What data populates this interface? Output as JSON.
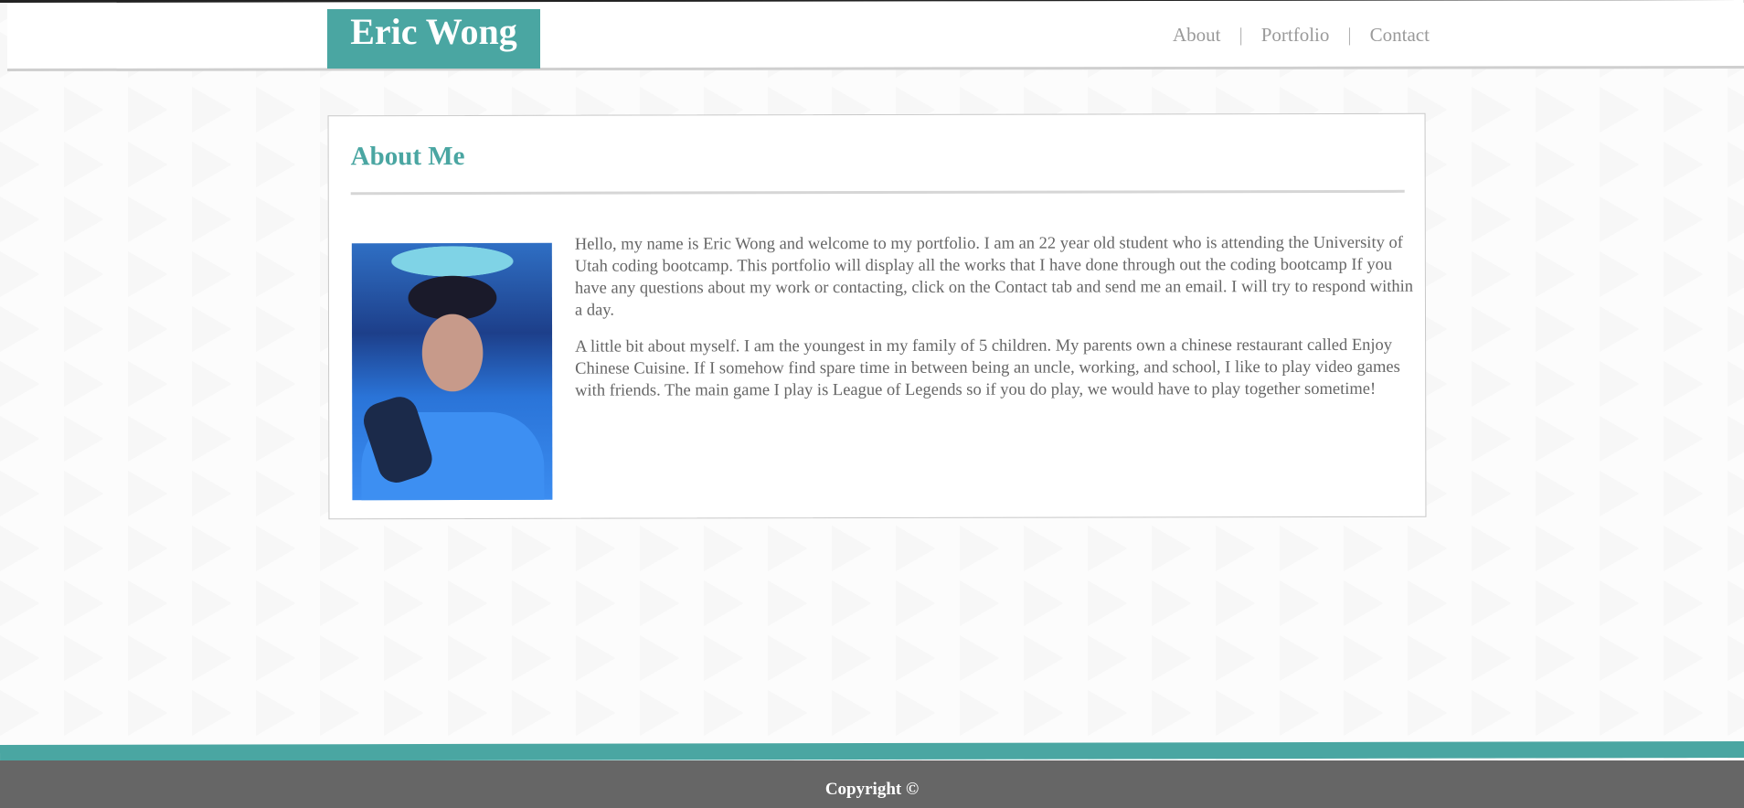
{
  "header": {
    "brand": "Eric Wong",
    "nav": [
      {
        "label": "About"
      },
      {
        "label": "Portfolio"
      },
      {
        "label": "Contact"
      }
    ],
    "separator": "|"
  },
  "about": {
    "title": "About Me",
    "photo_alt": "Portrait photo of Eric Wong",
    "paragraphs": [
      "Hello, my name is Eric Wong and welcome to my portfolio. I am an 22 year old student who is attending the University of Utah coding bootcamp. This portfolio will display all the works that I have done through out the coding bootcamp If you have any questions about my work or contacting, click on the Contact tab and send me an email. I will try to respond within a day.",
      "A little bit about myself. I am the youngest in my family of 5 children. My parents own a chinese restaurant called Enjoy Chinese Cuisine. If I somehow find spare time in between being an uncle, working, and school, I like to play video games with friends. The main game I play is League of Legends so if you do play, we would have to play together sometime!"
    ]
  },
  "footer": {
    "text": "Copyright ©"
  },
  "colors": {
    "accent": "#4aa6a2",
    "footer_bg": "#666666",
    "text_muted": "#666666",
    "nav_text": "#9a9a9a"
  }
}
